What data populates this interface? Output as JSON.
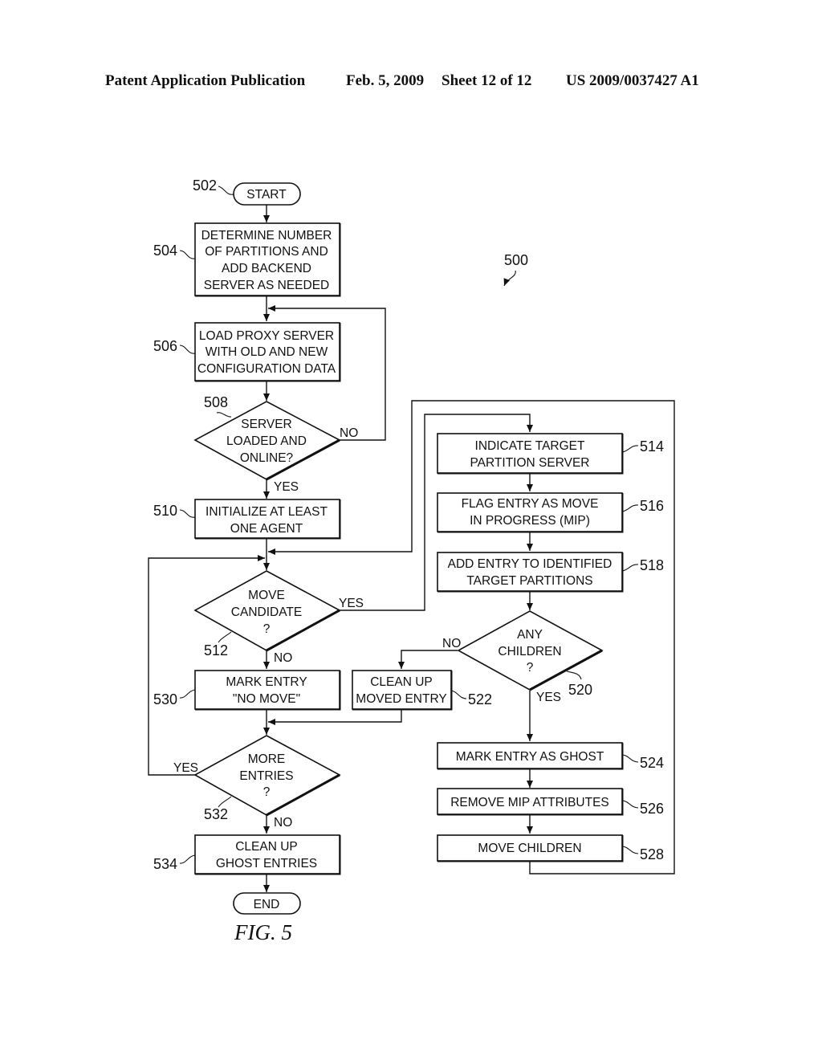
{
  "header": {
    "left": "Patent Application Publication",
    "date": "Feb. 5, 2009",
    "sheet": "Sheet 12 of 12",
    "number": "US 2009/0037427 A1"
  },
  "figure": {
    "ref": "500",
    "caption": "FIG. 5"
  },
  "nodes": {
    "start": {
      "ref": "502",
      "lines": [
        "START"
      ]
    },
    "n504": {
      "ref": "504",
      "lines": [
        "DETERMINE NUMBER",
        "OF PARTITIONS AND",
        "ADD BACKEND",
        "SERVER AS NEEDED"
      ]
    },
    "n506": {
      "ref": "506",
      "lines": [
        "LOAD PROXY SERVER",
        "WITH OLD AND NEW",
        "CONFIGURATION DATA"
      ]
    },
    "n508": {
      "ref": "508",
      "lines": [
        "SERVER",
        "LOADED AND",
        "ONLINE?"
      ]
    },
    "n510": {
      "ref": "510",
      "lines": [
        "INITIALIZE AT LEAST",
        "ONE AGENT"
      ]
    },
    "n512": {
      "ref": "512",
      "lines": [
        "MOVE",
        "CANDIDATE",
        "?"
      ]
    },
    "n514": {
      "ref": "514",
      "lines": [
        "INDICATE TARGET",
        "PARTITION SERVER"
      ]
    },
    "n516": {
      "ref": "516",
      "lines": [
        "FLAG ENTRY AS MOVE",
        "IN PROGRESS (MIP)"
      ]
    },
    "n518": {
      "ref": "518",
      "lines": [
        "ADD ENTRY TO IDENTIFIED",
        "TARGET PARTITIONS"
      ]
    },
    "n520": {
      "ref": "520",
      "lines": [
        "ANY",
        "CHILDREN",
        "?"
      ]
    },
    "n522": {
      "ref": "522",
      "lines": [
        "CLEAN UP",
        "MOVED ENTRY"
      ]
    },
    "n524": {
      "ref": "524",
      "lines": [
        "MARK ENTRY AS GHOST"
      ]
    },
    "n526": {
      "ref": "526",
      "lines": [
        "REMOVE MIP ATTRIBUTES"
      ]
    },
    "n528": {
      "ref": "528",
      "lines": [
        "MOVE CHILDREN"
      ]
    },
    "n530": {
      "ref": "530",
      "lines": [
        "MARK ENTRY",
        "\"NO MOVE\""
      ]
    },
    "n532": {
      "ref": "532",
      "lines": [
        "MORE",
        "ENTRIES",
        "?"
      ]
    },
    "n534": {
      "ref": "534",
      "lines": [
        "CLEAN UP",
        "GHOST ENTRIES"
      ]
    },
    "end": {
      "lines": [
        "END"
      ]
    }
  },
  "edge_labels": {
    "n508_no": "NO",
    "n508_yes": "YES",
    "n512_yes": "YES",
    "n512_no": "NO",
    "n520_no": "NO",
    "n520_yes": "YES",
    "n532_yes": "YES",
    "n532_no": "NO"
  }
}
